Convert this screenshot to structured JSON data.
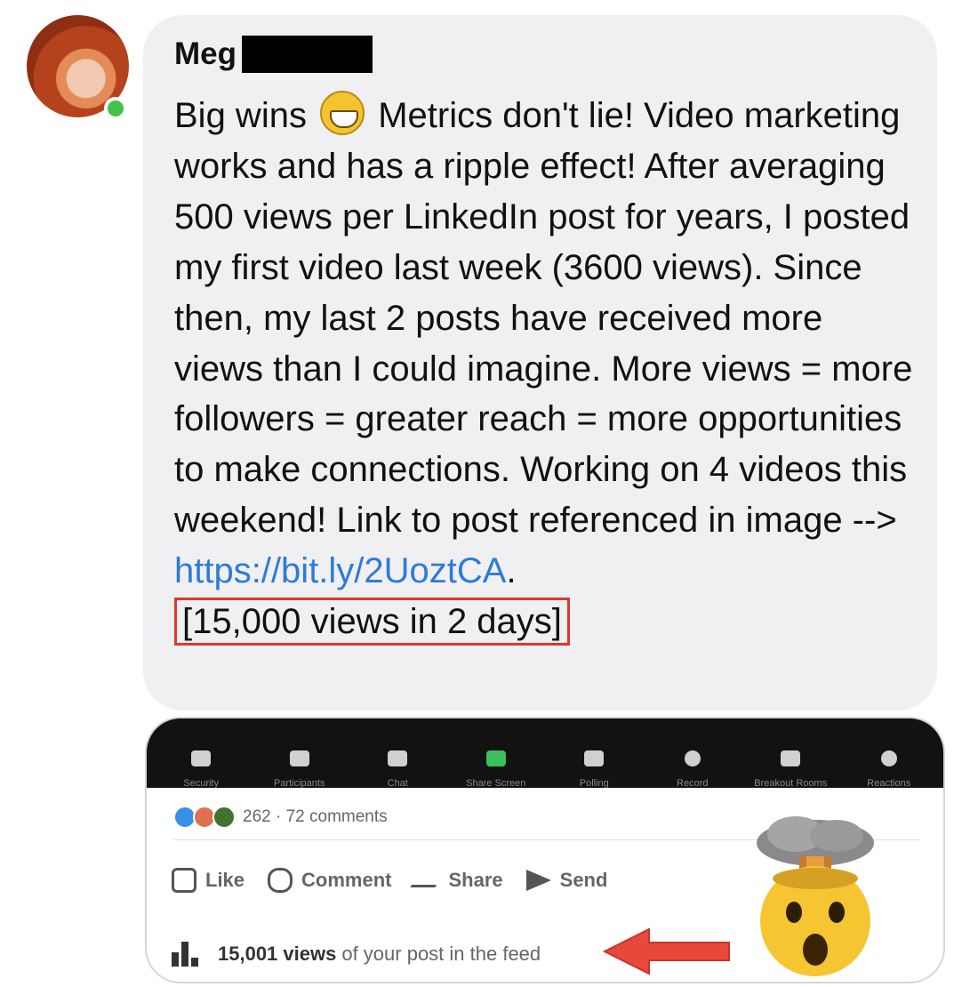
{
  "sender": {
    "name": "Meg"
  },
  "message": {
    "line1_before_emoji": "Big wins",
    "line1_after_emoji": "Metrics don't lie! Video marketing works and has a ripple effect! After averaging 500 views per LinkedIn post for years, I posted my first video last week (3600 views). Since then, my last 2 posts have received more views than I could imagine. More views = more followers = greater reach = more opportunities to make connections. Working on 4 videos this weekend! Link to post referenced in image -->",
    "link_text": "https://bit.ly/2UoztCA",
    "after_link": ".",
    "highlight": "[15,000 views in 2 days]"
  },
  "emoji": {
    "inline": "grinning-face",
    "card": "exploding-head"
  },
  "zoom_toolbar": [
    {
      "label": "Security",
      "icon": "shield-icon"
    },
    {
      "label": "Participants",
      "icon": "people-icon"
    },
    {
      "label": "Chat",
      "icon": "chat-icon"
    },
    {
      "label": "Share Screen",
      "icon": "share-screen-icon"
    },
    {
      "label": "Polling",
      "icon": "polling-icon"
    },
    {
      "label": "Record",
      "icon": "record-icon"
    },
    {
      "label": "Breakout Rooms",
      "icon": "grid-icon"
    },
    {
      "label": "Reactions",
      "icon": "emoji-icon"
    }
  ],
  "post": {
    "reactions_count": "262",
    "reactions_sep": " · ",
    "comments": "72 comments",
    "actions": [
      "Like",
      "Comment",
      "Share",
      "Send"
    ],
    "views_count": "15,001 views",
    "views_tail": "of your post in the feed"
  },
  "colors": {
    "link": "#2f7bd6",
    "highlight_border": "#e0382b",
    "bubble": "#f0f0f2",
    "presence": "#42c34a"
  }
}
